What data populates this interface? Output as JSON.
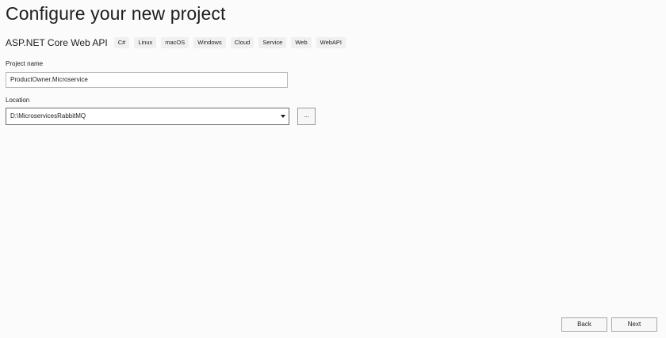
{
  "header": {
    "title": "Configure your new project"
  },
  "template": {
    "name": "ASP.NET Core Web API",
    "tags": [
      "C#",
      "Linux",
      "macOS",
      "Windows",
      "Cloud",
      "Service",
      "Web",
      "WebAPI"
    ]
  },
  "form": {
    "project_name_label": "Project name",
    "project_name_value": "ProductOwner.Microservice",
    "location_label": "Location",
    "location_value": "D:\\MicroservicesRabbitMQ",
    "browse_label": "..."
  },
  "footer": {
    "back_label": "Back",
    "next_label": "Next"
  }
}
